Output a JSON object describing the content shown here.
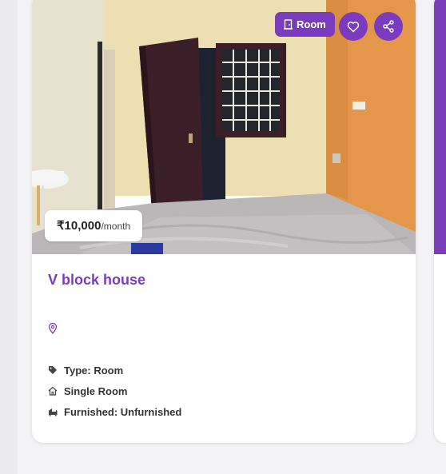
{
  "listing": {
    "badge_label": "Room",
    "price_amount": "₹10,000",
    "price_period": "/month",
    "title": "V block house",
    "location": "",
    "details": {
      "type": "Type: Room",
      "room_kind": "Single Room",
      "furnished": "Furnished: Unfurnished"
    }
  },
  "icons": {
    "badge": "door-icon",
    "favorite": "heart-icon",
    "share": "share-icon",
    "location": "map-pin-icon",
    "type": "tag-icon",
    "room_kind": "home-icon",
    "furnished": "sofa-icon"
  },
  "colors": {
    "accent": "#7b3bbf",
    "card": "#ffffff",
    "background": "#f3f3f5",
    "text": "#333333"
  }
}
